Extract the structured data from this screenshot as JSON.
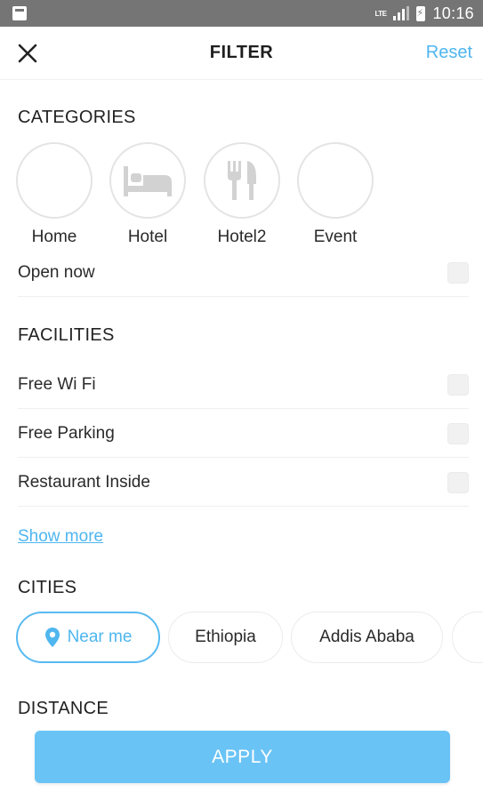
{
  "status_bar": {
    "time": "10:16",
    "network": "LTE"
  },
  "header": {
    "title": "FILTER",
    "reset_label": "Reset"
  },
  "categories": {
    "title": "CATEGORIES",
    "items": [
      {
        "label": "Home",
        "icon": ""
      },
      {
        "label": "Hotel",
        "icon": "bed-icon"
      },
      {
        "label": "Hotel2",
        "icon": "restaurant-icon"
      },
      {
        "label": "Event",
        "icon": ""
      }
    ]
  },
  "open_now": {
    "label": "Open now",
    "checked": false
  },
  "facilities": {
    "title": "FACILITIES",
    "items": [
      {
        "label": "Free Wi Fi",
        "checked": false
      },
      {
        "label": "Free Parking",
        "checked": false
      },
      {
        "label": "Restaurant Inside",
        "checked": false
      }
    ],
    "show_more": "Show more"
  },
  "cities": {
    "title": "CITIES",
    "chips": [
      {
        "label": "Near me",
        "icon": "location-pin-icon",
        "selected": true
      },
      {
        "label": "Ethiopia",
        "selected": false
      },
      {
        "label": "Addis Ababa",
        "selected": false
      }
    ]
  },
  "distance": {
    "title": "DISTANCE"
  },
  "apply_label": "APPLY",
  "colors": {
    "accent": "#4fb6ef",
    "apply_bg": "#6ac3f5",
    "status_bar": "#757575"
  }
}
